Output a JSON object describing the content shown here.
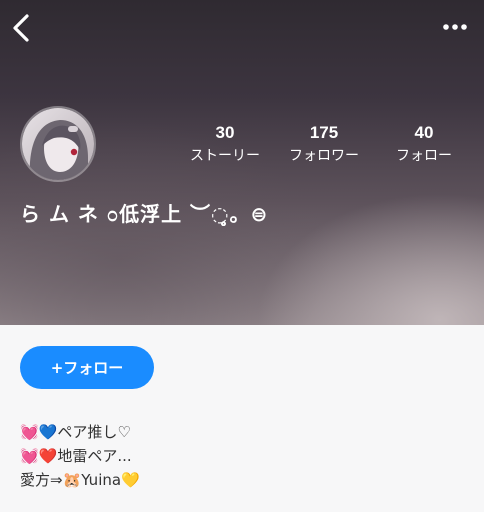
{
  "header": {
    "back_icon": "chevron-left-icon",
    "more_icon": "more-horizontal-icon"
  },
  "profile": {
    "avatar_icon": "avatar-image",
    "name": "ら ム ネ ೦低浮上 ︶◌̥̥̥̥。⊜",
    "stats": [
      {
        "value": "30",
        "label": "ストーリー"
      },
      {
        "value": "175",
        "label": "フォロワー"
      },
      {
        "value": "40",
        "label": "フォロー"
      }
    ]
  },
  "actions": {
    "follow_label": "+フォロー",
    "follow_color": "#1a8cff"
  },
  "bio": {
    "lines": [
      "💓💙ペア推し♡",
      "💓❤️地雷ペア...",
      "愛方⇒🐹Yuina💛"
    ]
  }
}
